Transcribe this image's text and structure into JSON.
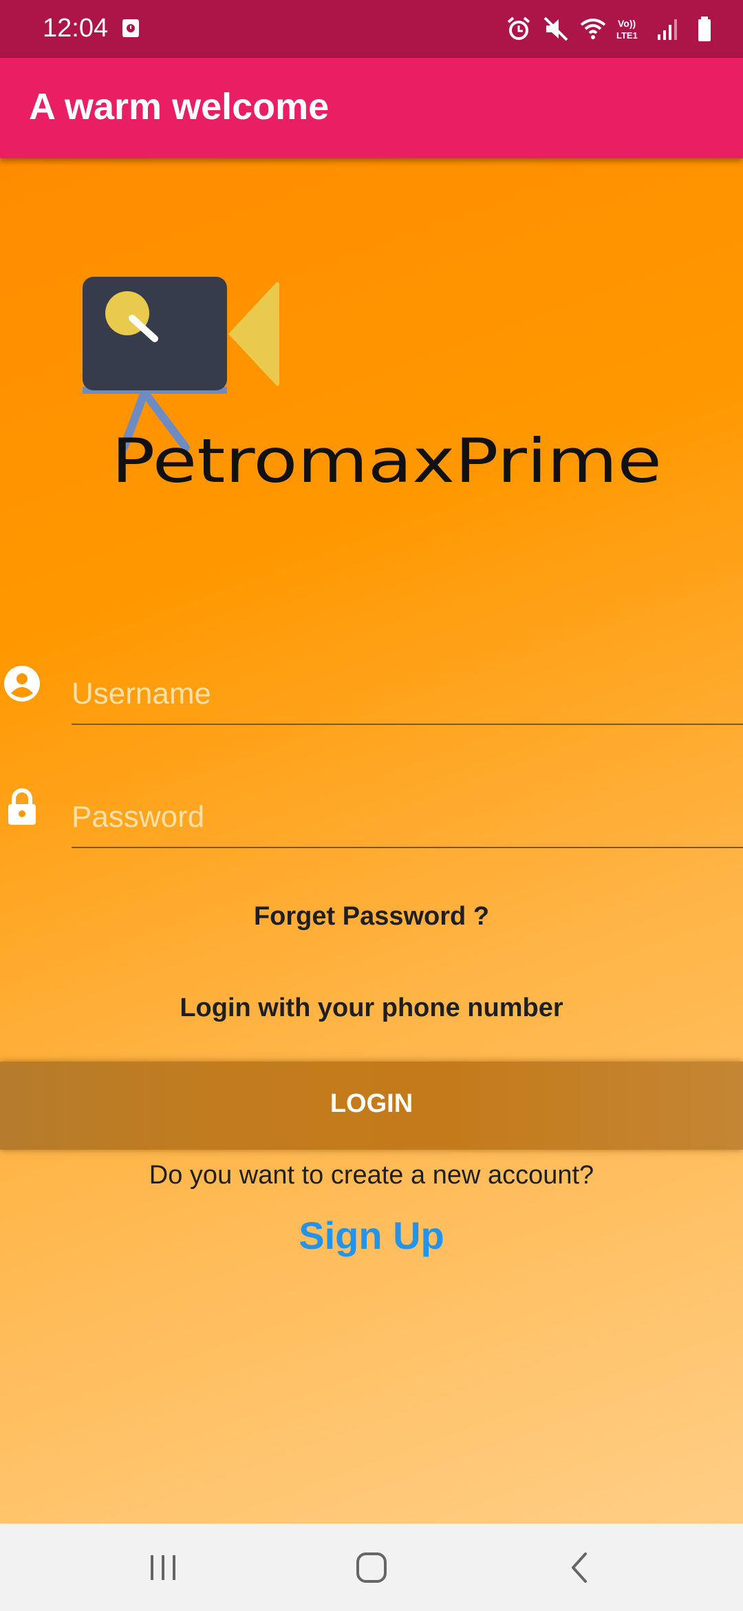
{
  "status_bar": {
    "time": "12:04",
    "icons": [
      "screenshot-icon",
      "alarm-icon",
      "mute-icon",
      "wifi-icon",
      "volte-lte-icon",
      "signal-icon",
      "battery-icon"
    ]
  },
  "app_bar": {
    "title": "A warm welcome"
  },
  "logo": {
    "brand_text": "PetromaxPrime"
  },
  "form": {
    "username_placeholder": "Username",
    "password_placeholder": "Password",
    "forget_password": "Forget Password ?",
    "phone_login": "Login with your phone number",
    "login_label": "LOGIN",
    "create_account_prompt": "Do you want to create a new account?",
    "signup_label": "Sign Up"
  },
  "nav_bar": {
    "icons": [
      "recent-apps-icon",
      "home-icon",
      "back-icon"
    ]
  },
  "colors": {
    "status_bar": "#ad1548",
    "app_bar": "#e91e63",
    "background_top": "#ff9800",
    "background_bottom": "#ffce86",
    "login_button": "#c27c1e",
    "signup_link": "#2394e8"
  }
}
